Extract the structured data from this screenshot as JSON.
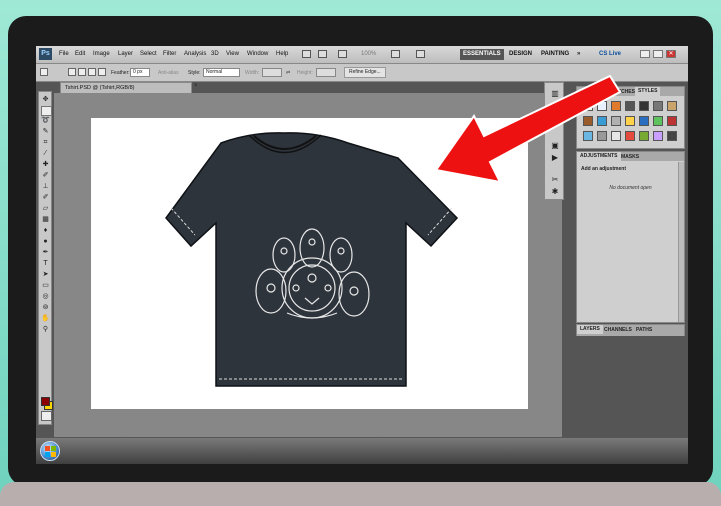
{
  "app": {
    "logo": "Ps",
    "menu": [
      "File",
      "Edit",
      "Image",
      "Layer",
      "Select",
      "Filter",
      "Analysis",
      "3D",
      "View",
      "Window",
      "Help"
    ],
    "zoom": "100%",
    "workspaces": {
      "essentials": "ESSENTIALS",
      "design": "DESIGN",
      "painting": "PAINTING",
      "more": "»"
    },
    "cs_live": "CS Live"
  },
  "options_bar": {
    "feather_label": "Feather:",
    "feather_value": "0 px",
    "antialias_label": "Anti-alias",
    "style_label": "Style:",
    "style_value": "Normal",
    "width_label": "Width:",
    "height_label": "Height:",
    "refine_edge": "Refine Edge..."
  },
  "document": {
    "tab_title": "Tshirt.PSD @ (Tshirt,RGB/8)",
    "close_glyph": "×"
  },
  "panels": {
    "top": {
      "tabs": [
        "SWATCHES",
        "STYLES"
      ],
      "active": "STYLES"
    },
    "adjustments": {
      "tabs": [
        "ADJUSTMENTS",
        "MASKS"
      ],
      "title": "Add an adjustment",
      "empty_text": "No document open"
    },
    "bottom": {
      "tabs": [
        "LAYERS",
        "CHANNELS",
        "PATHS"
      ]
    }
  },
  "colors": {
    "shirt": "#2e343c",
    "arrow": "#ee1111",
    "foreground": "#8b0000",
    "background": "#ffd700"
  },
  "icons": {
    "annotation": "red-arrow-icon",
    "start": "windows-start-orb-icon"
  }
}
